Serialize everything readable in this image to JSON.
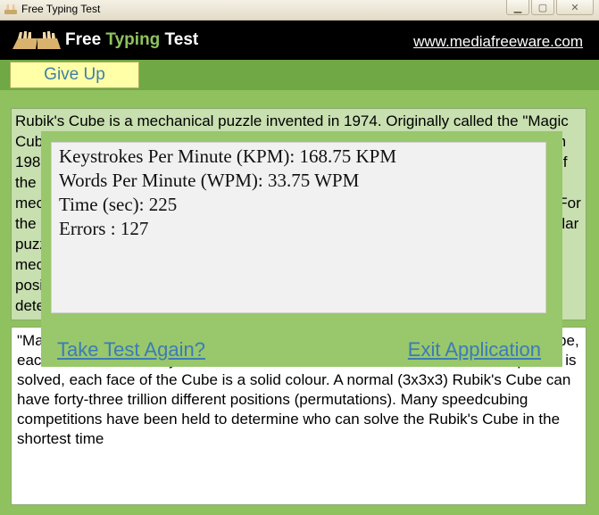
{
  "window": {
    "title": "Free Typing Test",
    "icon": "hands-keyboard-icon",
    "buttons": [
      "minimize",
      "maximize",
      "close"
    ]
  },
  "header": {
    "brand_free": "Free ",
    "brand_typing": "Typing",
    "brand_test": " Test",
    "site": "www.mediafreeware.com"
  },
  "toolbar": {
    "give_up": "Give Up"
  },
  "source_text": "Rubik's Cube is a mechanical puzzle invented in 1974. Originally called the \"Magic Cube\", the puzzle was licensed by Rubik to be manufactured by Ideal Toy Corp. in 1980. It is said to be the world's best-selling toy. In a classic Rubik's Cube, each of the six faces is covered by nine stickers, each of one of six solid colours. A pivot mechanism enables each face to turn independently, thus mixing up the colours. For the puzzle to be solved, each face must be returned to have only one colour. Similar puzzles have now been made with various numbers of sides, dimensions, and mechanisms. A normal (3x3x3) Rubik's Cube can have forty-three trillion different positions (permutations). Many speedcubing competitions have been held to determine who can solve the Rubik's Cube in the shortest time",
  "typed_text": "\"Ma... is said... Cube... six unique miniature cubes on the surface. In a typical Cube, each face is covered by nine stickers of one of six solid colours. When the puzzle is solved, each face of the Cube is a solid colour. A normal (3x3x3) Rubik's Cube can have forty-three trillion different positions (permutations). Many speedcubing competitions have been held to determine who can solve the Rubik's Cube in the shortest time",
  "results": {
    "kpm": "Keystrokes Per Minute (KPM): 168.75 KPM",
    "wpm": "Words Per Minute (WPM): 33.75 WPM",
    "time": "Time (sec): 225",
    "errors": "Errors : 127"
  },
  "actions": {
    "take_again": "Take Test Again?",
    "exit": "Exit Application"
  },
  "colors": {
    "background": "#8fc25e",
    "header": "#000000",
    "accent_green": "#8fc25e",
    "give_up_bg": "#ffffa8",
    "link": "#3b7bb8"
  }
}
